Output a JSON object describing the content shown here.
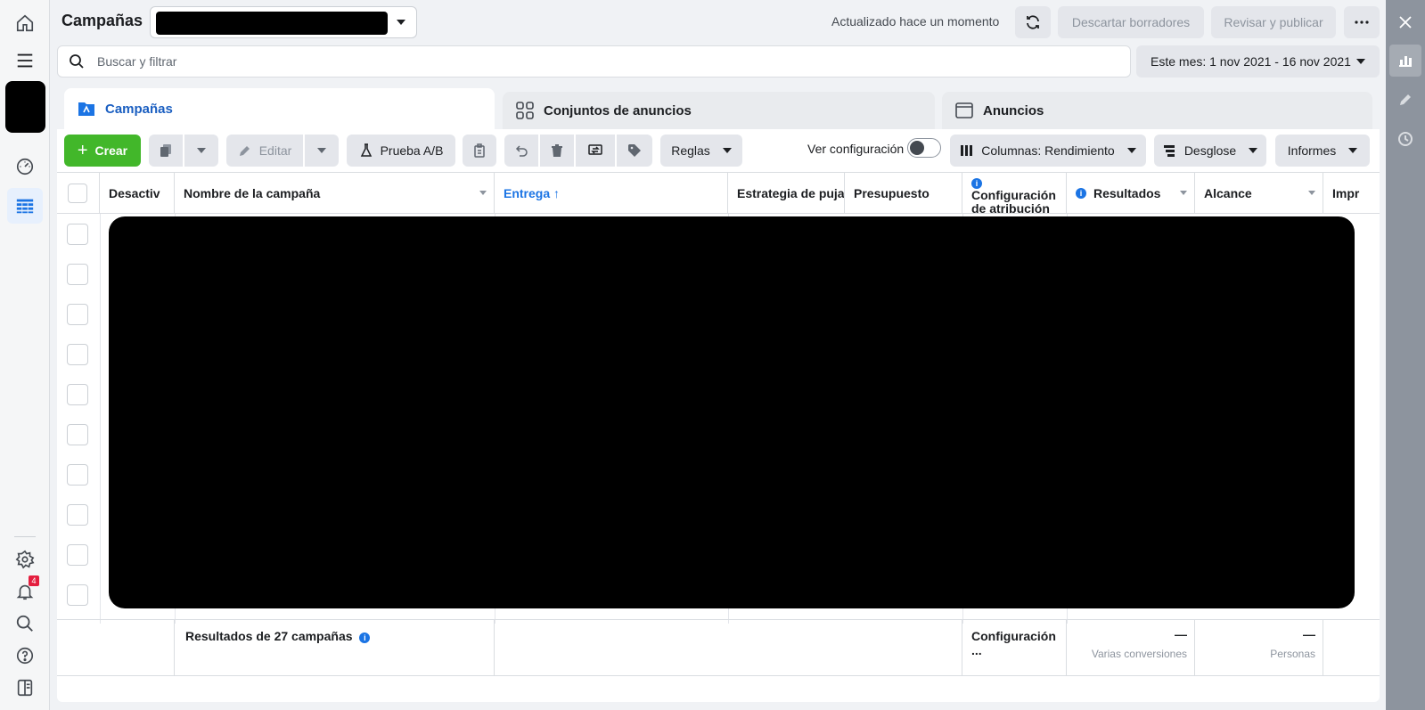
{
  "header": {
    "title": "Campañas",
    "status": "Actualizado hace un momento",
    "discard_label": "Descartar borradores",
    "publish_label": "Revisar y publicar"
  },
  "search": {
    "placeholder": "Buscar y filtrar"
  },
  "date_range": "Este mes: 1 nov 2021 - 16 nov 2021",
  "tabs": [
    {
      "label": "Campañas",
      "active": true
    },
    {
      "label": "Conjuntos de anuncios",
      "active": false
    },
    {
      "label": "Anuncios",
      "active": false
    }
  ],
  "toolbar": {
    "create_label": "Crear",
    "edit_label": "Editar",
    "ab_test_label": "Prueba A/B",
    "rules_label": "Reglas",
    "view_config_label": "Ver configuración",
    "columns_label": "Columnas: Rendimiento",
    "breakdown_label": "Desglose",
    "reports_label": "Informes"
  },
  "table": {
    "columns": [
      {
        "label": "Desactiv"
      },
      {
        "label": "Nombre de la campaña"
      },
      {
        "label": "Entrega ↑"
      },
      {
        "label": "Estrategia de puja"
      },
      {
        "label": "Presupuesto"
      },
      {
        "label": "Configuración de atribución"
      },
      {
        "label": "Resultados"
      },
      {
        "label": "Alcance"
      },
      {
        "label": "Impr"
      }
    ],
    "footer": {
      "summary": "Resultados de 27 campañas",
      "attribution": "Configuración ...",
      "results_value": "—",
      "results_sub": "Varias conversiones",
      "reach_value": "—",
      "reach_sub": "Personas"
    }
  },
  "notifications": {
    "count": "4"
  },
  "colors": {
    "accent": "#1b74e4",
    "create_button": "#42b72a",
    "active_tab_text": "#1b5fc1"
  }
}
